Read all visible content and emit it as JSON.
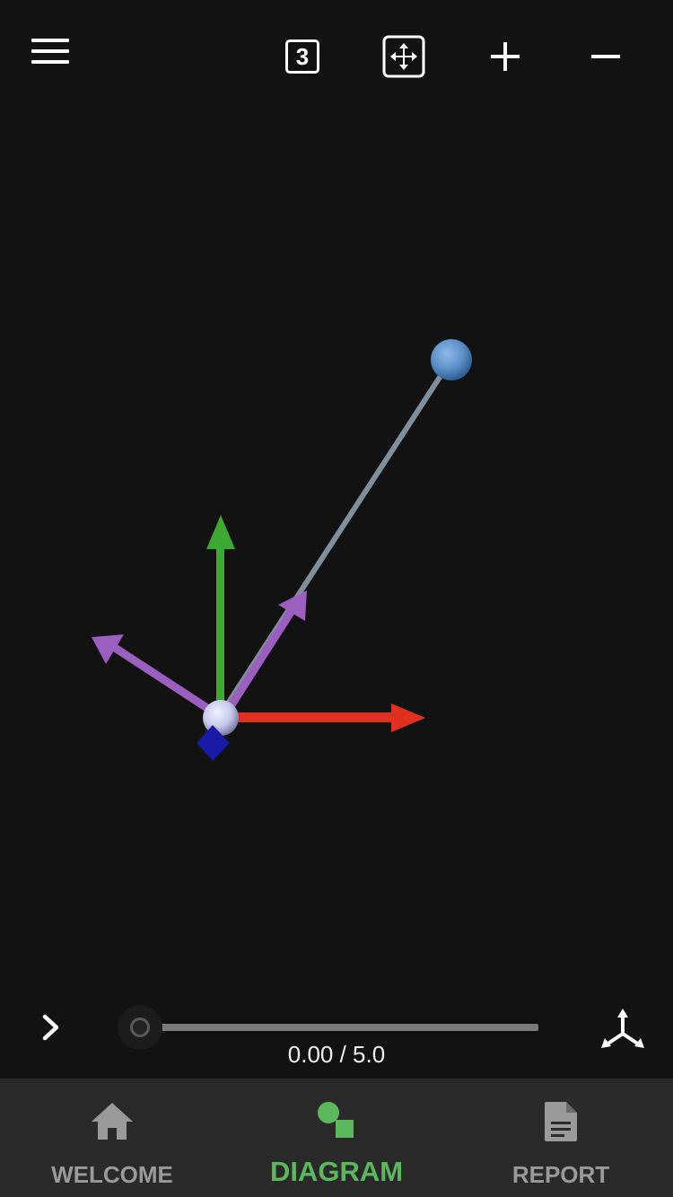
{
  "toolbar": {
    "view_button_label": "3",
    "icons": [
      "menu-icon",
      "view-3d-icon",
      "fit-to-screen-icon",
      "zoom-in-icon",
      "zoom-out-icon"
    ]
  },
  "scene": {
    "arrow_colors": {
      "x_axis": "#e03020",
      "y_axis": "#3caa32",
      "vectors": "#9b5fc0",
      "rod": "#7f8f9c",
      "bob": "#5b8fc7",
      "pivot": "#c7c9ea",
      "marker": "#1a1aa8"
    }
  },
  "playback": {
    "play_icon": "chevron-right-icon",
    "time_display": "0.00 / 5.0",
    "progress": 0.0,
    "axes_icon": "axes-triad-icon"
  },
  "nav": {
    "items": [
      {
        "label": "WELCOME",
        "icon": "home-icon",
        "active": false
      },
      {
        "label": "DIAGRAM",
        "icon": "diagram-icon",
        "active": true
      },
      {
        "label": "REPORT",
        "icon": "report-icon",
        "active": false
      }
    ],
    "active_color": "#5cb85c",
    "inactive_color": "#9a9a9a"
  }
}
